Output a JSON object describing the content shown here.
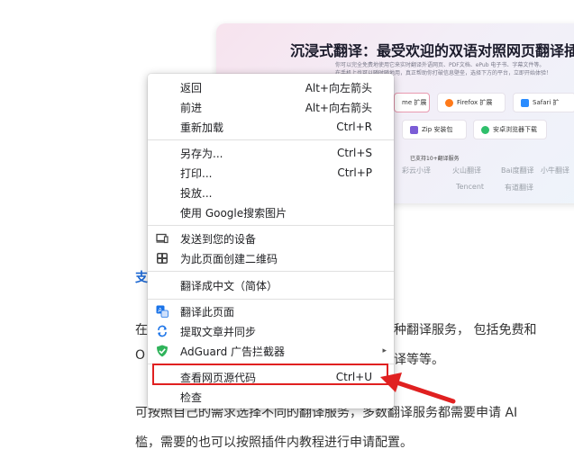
{
  "background": {
    "banner_title": "沉浸式翻译：最受欢迎的双语对照网页翻译插件",
    "banner_sub1": "你可以完全免费地使用它来实时翻译外语网页、PDF文档、ePub 电子书、字幕文件等。",
    "banner_sub2": "在手机上也可以随时随地用，真正帮助你打破信息壁垒，选择下方的平台，立即开始体验！",
    "buttons": [
      "me 扩展",
      "Firefox 扩展",
      "Safari 扩",
      "Zip 安装包",
      "安卓浏览器下载"
    ],
    "supported_label": "已支持10+翻译服务",
    "brands": [
      "彩云小译",
      "火山翻译",
      "Bai度翻译",
      "小牛翻译",
      "Tencent",
      "有道翻译"
    ],
    "partial_link": "支",
    "paragraph_lines": [
      "在",
      "种翻译服务， 包括免费和",
      "O",
      "译等等。",
      "可按照自己的需求选择不同的翻译服务，多数翻译服务都需要申请 AI",
      "槛，需要的也可以按照插件内教程进行申请配置。"
    ]
  },
  "menu": {
    "items": [
      {
        "label": "返回",
        "shortcut": "Alt+向左箭头"
      },
      {
        "label": "前进",
        "shortcut": "Alt+向右箭头"
      },
      {
        "label": "重新加载",
        "shortcut": "Ctrl+R"
      },
      {
        "label": "另存为...",
        "shortcut": "Ctrl+S"
      },
      {
        "label": "打印...",
        "shortcut": "Ctrl+P"
      },
      {
        "label": "投放...",
        "shortcut": ""
      },
      {
        "label": "使用 Google搜索图片",
        "shortcut": ""
      },
      {
        "label": "发送到您的设备",
        "shortcut": "",
        "icon": "devices-icon"
      },
      {
        "label": "为此页面创建二维码",
        "shortcut": "",
        "icon": "qr-code-icon"
      },
      {
        "label": "翻译成中文（简体）",
        "shortcut": ""
      },
      {
        "label": "翻译此页面",
        "shortcut": "",
        "icon": "translate-icon"
      },
      {
        "label": "提取文章并同步",
        "shortcut": "",
        "icon": "sync-icon"
      },
      {
        "label": "AdGuard 广告拦截器",
        "shortcut": "",
        "icon": "adguard-shield-icon",
        "submenu": "▸"
      },
      {
        "label": "查看网页源代码",
        "shortcut": "Ctrl+U"
      },
      {
        "label": "检查",
        "shortcut": ""
      }
    ]
  },
  "colors": {
    "highlight": "#e02020",
    "adguard": "#2fb35a",
    "translate": "#1a73e8"
  }
}
